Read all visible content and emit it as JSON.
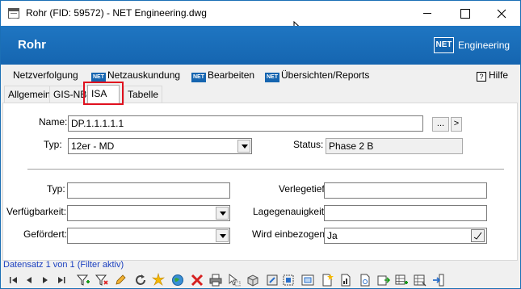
{
  "window": {
    "title": "Rohr (FID: 59572) - NET Engineering.dwg"
  },
  "header": {
    "title": "Rohr",
    "logo_badge": "NET",
    "logo_text": "Engineering",
    "brand_color": "#1565b0"
  },
  "menu": {
    "items": [
      {
        "label": "Netzverfolgung",
        "badge": ""
      },
      {
        "label": "Netzauskundung",
        "badge": "NET"
      },
      {
        "label": "Bearbeiten",
        "badge": "NET"
      },
      {
        "label": "Übersichten/Reports",
        "badge": "NET"
      }
    ],
    "help_label": "Hilfe",
    "help_glyph": "?"
  },
  "tabs": [
    {
      "label": "Allgemein",
      "active": false
    },
    {
      "label": "GIS-NB",
      "active": false
    },
    {
      "label": "ISA",
      "active": true
    },
    {
      "label": "Tabelle",
      "active": false
    }
  ],
  "form": {
    "name_label": "Name:",
    "name_value": "DP.1.1.1.1.1",
    "ellipsis_button": "...",
    "next_button": ">",
    "typ_label": "Typ:",
    "typ_value": "12er - MD",
    "status_label": "Status:",
    "status_value": "Phase 2 B"
  },
  "isa": {
    "typ_label": "Typ:",
    "typ_value": "",
    "verfuegbarkeit_label": "Verfügbarkeit:",
    "verfuegbarkeit_value": "",
    "gefoerdert_label": "Gefördert:",
    "gefoerdert_value": "",
    "verlegetiefe_label": "Verlegetiefe:",
    "verlegetiefe_value": "",
    "lagegenauigkeit_label": "Lagegenauigkeit:",
    "lagegenauigkeit_value": "",
    "wird_einbezogen_label": "Wird einbezogen:",
    "wird_einbezogen_value": "Ja"
  },
  "status_bar": {
    "text": "Datensatz 1 von 1 (Filter aktiv)"
  },
  "highlight_color": "#e0101e"
}
